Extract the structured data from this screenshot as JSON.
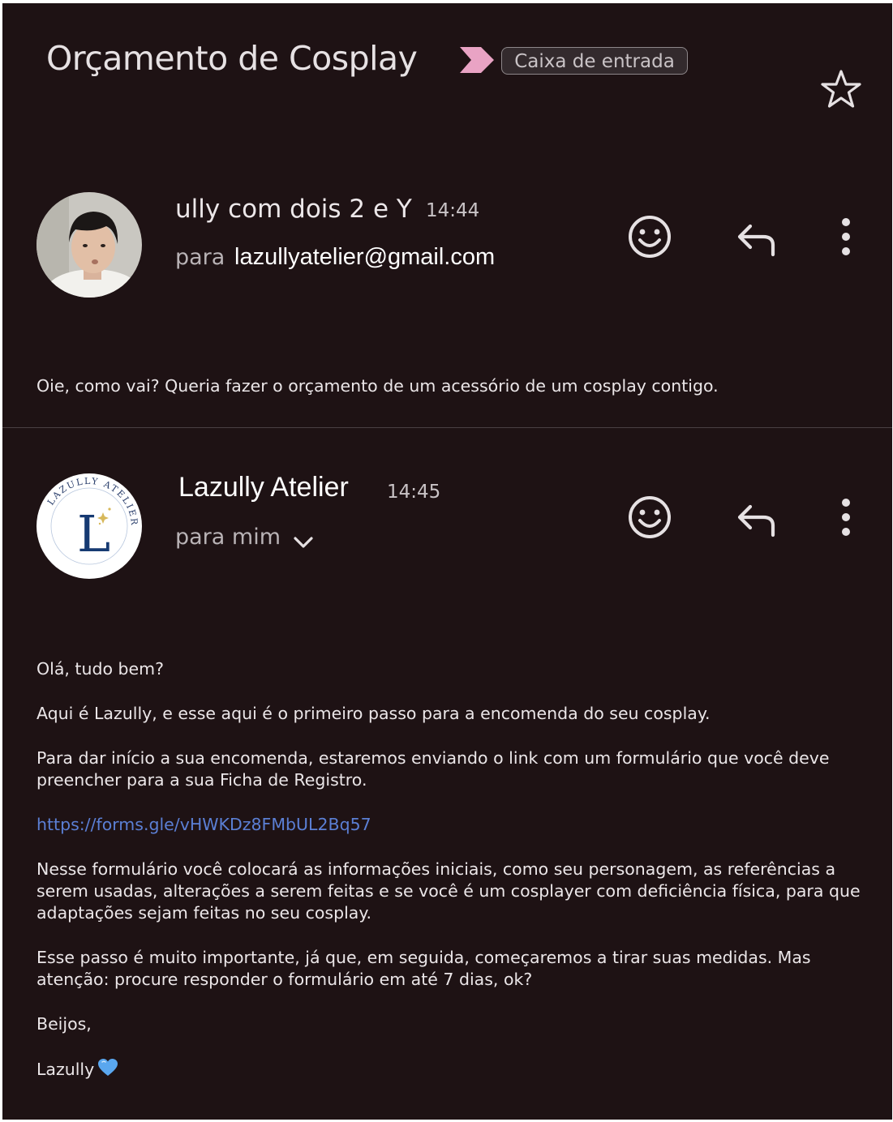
{
  "thread": {
    "subject": "Orçamento de Cosplay",
    "label": "Caixa de entrada",
    "colors": {
      "background": "#1e1214",
      "important_marker": "#e9a3c4",
      "link": "#5b7fd4"
    }
  },
  "messages": [
    {
      "sender": "ully com dois 2 e Y",
      "time": "14:44",
      "to_prefix": "para",
      "to": "lazullyatelier@gmail.com",
      "body": [
        "Oie, como vai? Queria fazer o orçamento de um acessório de um cosplay contigo."
      ]
    },
    {
      "sender": "Lazully Atelier",
      "time": "14:45",
      "to_prefix": "para mim",
      "logo_text": "LAZULLY ATELIER",
      "logo_letter": "L",
      "body": [
        "Olá, tudo bem?",
        "Aqui é Lazully, e esse aqui é o primeiro passo para a encomenda do seu cosplay.",
        "Para dar início a sua encomenda, estaremos enviando o link com um formulário que você deve preencher para a sua Ficha de Registro.",
        "Nesse formulário você colocará as informações iniciais, como seu personagem, as referências a serem usadas, alterações a serem feitas e se você é um cosplayer com deficiência física, para que adaptações sejam feitas no seu cosplay.",
        "Esse passo é muito importante, já que, em seguida, começaremos a tirar suas medidas. Mas atenção: procure responder o formulário em até 7 dias, ok?",
        "Beijos,",
        "Lazully"
      ],
      "link": "https://forms.gle/vHWKDz8FMbUL2Bq57"
    }
  ],
  "icons": {
    "important": "important-marker-icon",
    "star": "star-icon",
    "emoji": "emoji-reaction-icon",
    "reply": "reply-icon",
    "more": "more-vert-icon",
    "expand": "chevron-down-icon",
    "heart": "blue-heart-icon"
  }
}
